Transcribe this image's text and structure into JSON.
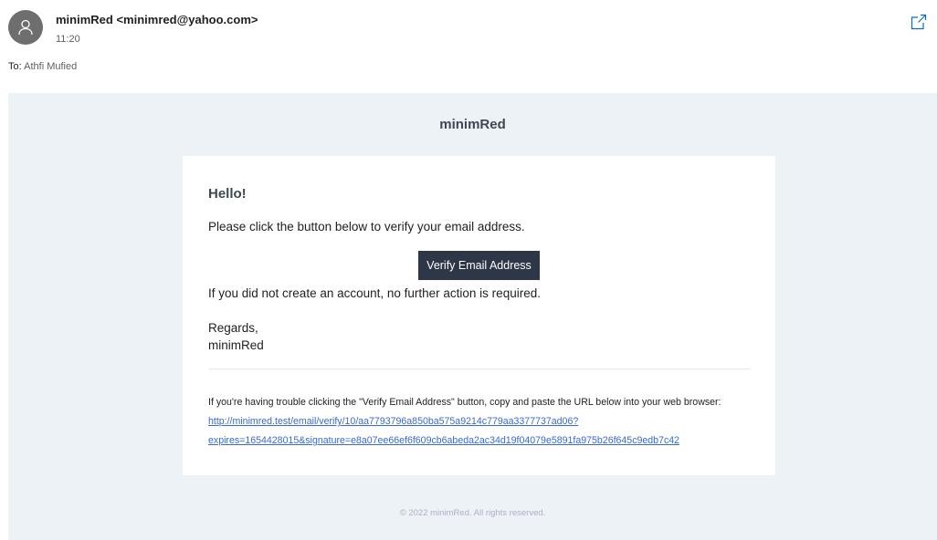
{
  "header": {
    "sender_name": "minimRed",
    "sender_email": "<minimred@yahoo.com>",
    "time": "11:20",
    "popout_icon": "popout-icon",
    "avatar_icon": "person-icon"
  },
  "recipients": {
    "label": "To:",
    "names": "Athfi Mufied"
  },
  "email": {
    "brand": "minimRed",
    "greeting": "Hello!",
    "intro": "Please click the button below to verify your email address.",
    "button_label": "Verify Email Address",
    "no_action": "If you did not create an account, no further action is required.",
    "regards": "Regards,",
    "signature": "minimRed",
    "subcopy_text": "If you're having trouble clicking the \"Verify Email Address\" button, copy and paste the URL below into your web browser: ",
    "subcopy_url": "http://minimred.test/email/verify/10/aa7793796a850ba575a9214c779aa3377737ad06?expires=1654428015&signature=e8a07ee66ef6f609cb6abeda2ac34d19f04079e5891fa975b26f645c9edb7c42",
    "footer": "© 2022 minimRed. All rights reserved."
  },
  "colors": {
    "wrapper_bg": "#edf2f7",
    "button_bg": "#2d3748",
    "link": "#3869d4",
    "avatar_bg": "#6e6e6e"
  }
}
